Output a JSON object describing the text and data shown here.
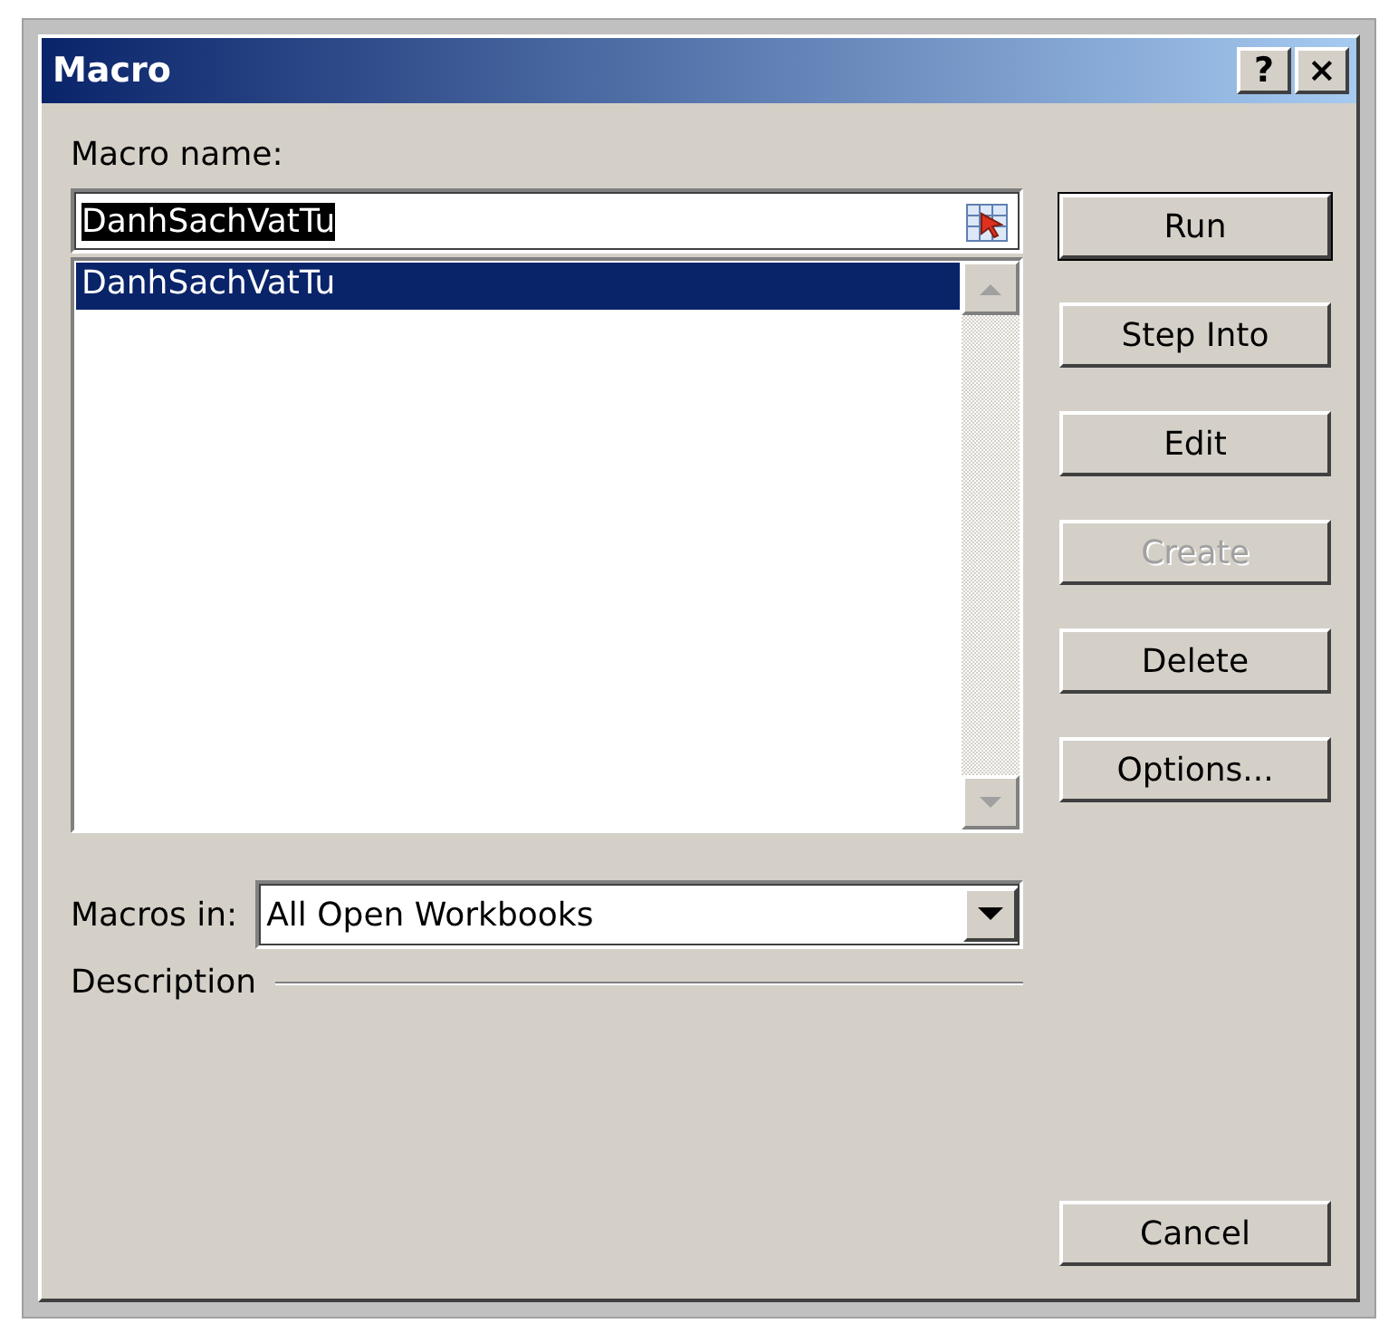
{
  "window": {
    "title": "Macro",
    "help_button": {
      "label": "?"
    },
    "close_button": {
      "label": "×"
    }
  },
  "macro_name": {
    "label": "Macro name:",
    "value": "DanhSachVatTu",
    "value_selected": true
  },
  "macro_list": {
    "items": [
      {
        "label": "DanhSachVatTu",
        "selected": true
      }
    ]
  },
  "buttons": [
    {
      "label": "Run",
      "default": true,
      "disabled": false
    },
    {
      "label": "Step Into",
      "default": false,
      "disabled": false
    },
    {
      "label": "Edit",
      "default": false,
      "disabled": false
    },
    {
      "label": "Create",
      "default": false,
      "disabled": true
    },
    {
      "label": "Delete",
      "default": false,
      "disabled": false
    },
    {
      "label": "Options...",
      "default": false,
      "disabled": false
    }
  ],
  "macros_in": {
    "label": "Macros in:",
    "value": "All Open Workbooks"
  },
  "description": {
    "label": "Description"
  },
  "cancel_button": {
    "label": "Cancel"
  }
}
